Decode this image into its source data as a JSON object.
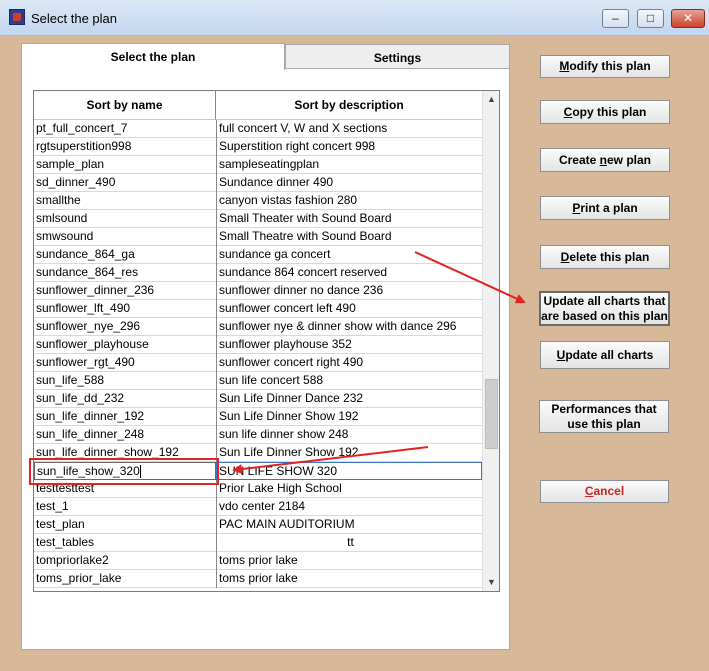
{
  "window": {
    "title": "Select the plan",
    "minimize_icon": "minimize-icon",
    "maximize_icon": "maximize-icon",
    "close_icon": "close-icon"
  },
  "tabs": [
    {
      "label": "Select the plan",
      "active": true
    },
    {
      "label": "Settings",
      "active": false
    }
  ],
  "grid": {
    "columns": [
      "Sort by name",
      "Sort by description"
    ],
    "rows": [
      {
        "name": "pt_full_concert_7",
        "desc": "full concert V, W and X sections"
      },
      {
        "name": "rgtsuperstition998",
        "desc": "Superstition right concert 998"
      },
      {
        "name": "sample_plan",
        "desc": "sampleseatingplan"
      },
      {
        "name": "sd_dinner_490",
        "desc": "Sundance dinner 490"
      },
      {
        "name": "smallthe",
        "desc": "canyon vistas fashion 280"
      },
      {
        "name": "smlsound",
        "desc": "Small Theater with Sound Board"
      },
      {
        "name": "smwsound",
        "desc": "Small Theatre with Sound Board"
      },
      {
        "name": "sundance_864_ga",
        "desc": "sundance ga concert"
      },
      {
        "name": "sundance_864_res",
        "desc": "sundance 864 concert reserved"
      },
      {
        "name": "sunflower_dinner_236",
        "desc": "sunflower dinner no dance 236"
      },
      {
        "name": "sunflower_lft_490",
        "desc": "sunflower concert left 490"
      },
      {
        "name": "sunflower_nye_296",
        "desc": "sunflower nye & dinner show with dance 296"
      },
      {
        "name": "sunflower_playhouse",
        "desc": "sunflower playhouse 352"
      },
      {
        "name": "sunflower_rgt_490",
        "desc": "sunflower concert right 490"
      },
      {
        "name": "sun_life_588",
        "desc": "sun life concert 588"
      },
      {
        "name": "sun_life_dd_232",
        "desc": "Sun Life Dinner Dance 232"
      },
      {
        "name": "sun_life_dinner_192",
        "desc": "Sun Life Dinner Show 192"
      },
      {
        "name": "sun_life_dinner_248",
        "desc": "sun life dinner show 248"
      },
      {
        "name": "sun_life_dinner_show_192",
        "desc": "Sun Life Dinner Show 192"
      },
      {
        "name": "sun_life_show_320",
        "desc": "SUN LIFE SHOW 320",
        "selected": true
      },
      {
        "name": "testtesttest",
        "desc": "Prior Lake High School"
      },
      {
        "name": "test_1",
        "desc": "vdo center 2184"
      },
      {
        "name": "test_plan",
        "desc": "PAC MAIN AUDITORIUM"
      },
      {
        "name": "test_tables",
        "desc": "tt",
        "centered": true
      },
      {
        "name": "tompriorlake2",
        "desc": "toms prior lake"
      },
      {
        "name": "toms_prior_lake",
        "desc": "toms prior lake"
      }
    ]
  },
  "buttons": {
    "modify": {
      "mnemonic": "M",
      "rest": "odify this plan"
    },
    "copy": {
      "mnemonic": "C",
      "rest": "opy this plan"
    },
    "create_pre": "Create ",
    "create_mn": "n",
    "create_post": "ew plan",
    "print": {
      "mnemonic": "P",
      "rest": "rint a plan"
    },
    "delete": {
      "mnemonic": "D",
      "rest": "elete this plan"
    },
    "update_based_line1": "Update all charts that",
    "update_based_line2": "are based on this plan",
    "update_all": {
      "mnemonic": "U",
      "rest": "pdate all charts"
    },
    "performances_line1": "Performances that",
    "performances_line2": "use this plan",
    "cancel": {
      "mnemonic": "C",
      "rest": "ancel"
    }
  },
  "colors": {
    "background": "#d7b999",
    "annotation_red": "#e32222",
    "cancel_text": "#c0281f"
  }
}
